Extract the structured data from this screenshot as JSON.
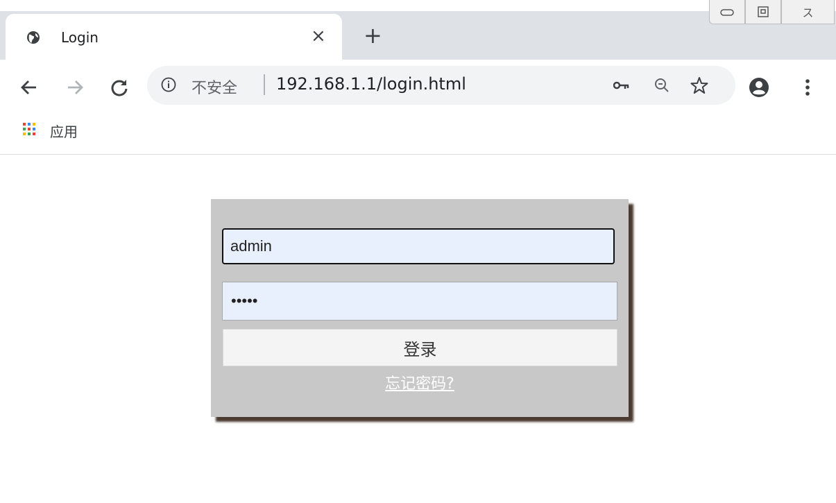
{
  "tab": {
    "title": "Login",
    "close_label": "×",
    "new_tab_label": "+"
  },
  "window_controls": {
    "minimize_label": "▭",
    "maximize_label": "▢",
    "close_label": "ス"
  },
  "toolbar": {
    "back_icon": "back-arrow-icon",
    "forward_icon": "forward-arrow-icon",
    "reload_icon": "reload-icon"
  },
  "omnibox": {
    "security_text": "不安全",
    "url": "192.168.1.1/login.html"
  },
  "bookmarks": {
    "apps_label": "应用"
  },
  "login": {
    "username_value": "admin",
    "password_value": "•••••",
    "submit_label": "登录",
    "forgot_label": "忘记密码?"
  },
  "colors": {
    "panel_bg": "#c8c8c8",
    "input_bg": "#e8f0fe",
    "shadow": "#4a3a30"
  }
}
